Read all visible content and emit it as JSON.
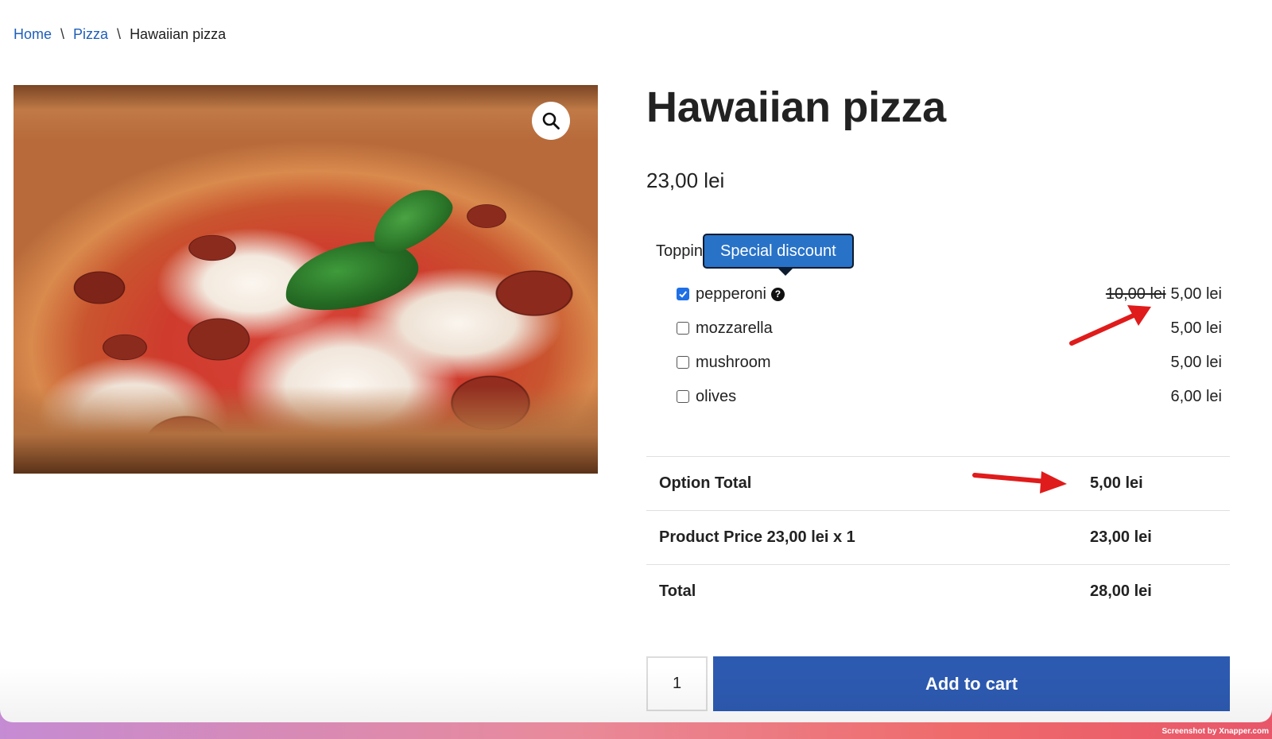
{
  "breadcrumb": {
    "items": [
      {
        "label": "Home"
      },
      {
        "label": "Pizza"
      },
      {
        "label": "Hawaiian pizza"
      }
    ],
    "separator": "\\"
  },
  "product": {
    "title": "Hawaiian pizza",
    "price": "23,00 lei",
    "zoom_icon": "magnifier-icon"
  },
  "toppings": {
    "label": "Toppin",
    "tooltip": "Special discount",
    "options": [
      {
        "name": "pepperoni",
        "checked": true,
        "has_help": true,
        "help_glyph": "?",
        "old_price": "10,00 lei",
        "price": "5,00 lei"
      },
      {
        "name": "mozzarella",
        "checked": false,
        "price": "5,00 lei"
      },
      {
        "name": "mushroom",
        "checked": false,
        "price": "5,00 lei"
      },
      {
        "name": "olives",
        "checked": false,
        "price": "6,00 lei"
      }
    ]
  },
  "summary": {
    "option_total_label": "Option Total",
    "option_total_value": "5,00 lei",
    "product_price_label": "Product Price 23,00 lei x 1",
    "product_price_value": "23,00 lei",
    "total_label": "Total",
    "total_value": "28,00 lei"
  },
  "cart": {
    "quantity": "1",
    "add_to_cart_label": "Add to cart"
  },
  "watermark": "Screenshot by Xnapper.com",
  "colors": {
    "link": "#1f5fb8",
    "button": "#2d5ab1",
    "tooltip": "#2872c8",
    "annotation_arrow": "#e01b1b"
  }
}
